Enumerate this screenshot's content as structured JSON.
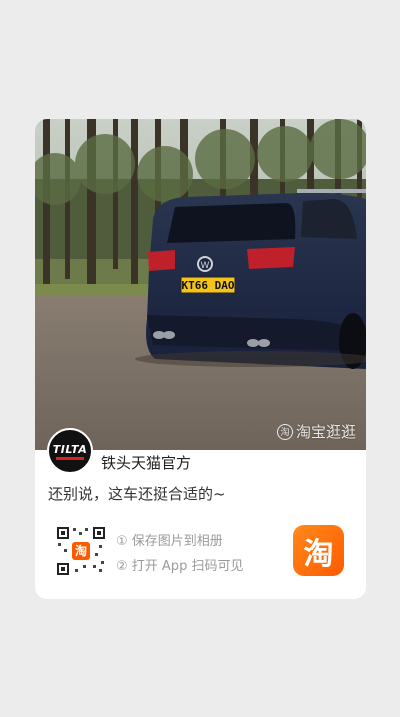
{
  "post": {
    "watermark": "淘宝逛逛",
    "watermark_icon": "taobao-logo-icon",
    "shop_name": "铁头天猫官方",
    "avatar_text": "TILTA",
    "description": "还别说，这车还挺合适的~",
    "license_plate": "KT66 DAO"
  },
  "instructions": {
    "step1": "① 保存图片到相册",
    "step2": "② 打开 App 扫码可见"
  },
  "app_icon": {
    "glyph": "淘",
    "color": "#ff6a00"
  },
  "qr": {
    "center_glyph": "淘"
  }
}
